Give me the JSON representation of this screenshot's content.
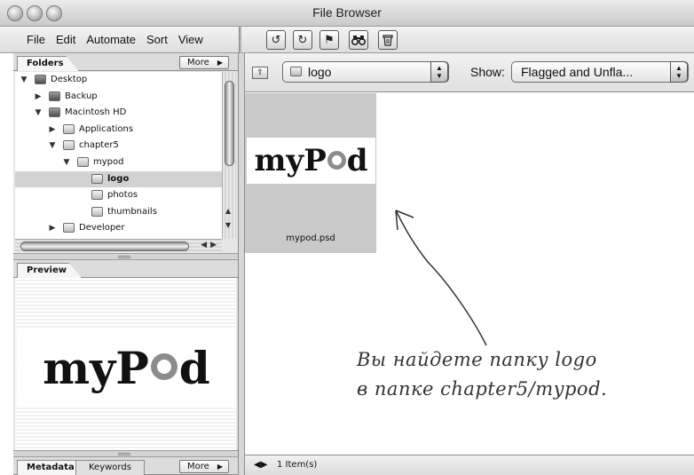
{
  "window": {
    "title": "File Browser"
  },
  "menu": [
    "File",
    "Edit",
    "Automate",
    "Sort",
    "View"
  ],
  "toolbar_buttons": [
    {
      "name": "rotate-ccw-icon",
      "glyph": "↺"
    },
    {
      "name": "rotate-cw-icon",
      "glyph": "↻"
    },
    {
      "name": "flag-icon",
      "glyph": "⚑"
    },
    {
      "name": "binoculars-icon",
      "glyph": "⊕"
    },
    {
      "name": "trash-icon",
      "glyph": "🗑"
    }
  ],
  "folders_panel": {
    "tab": "Folders",
    "more": "More",
    "tree": [
      {
        "label": "Desktop",
        "depth": 0,
        "expanded": true,
        "icon": "desktop-icon",
        "selected": false
      },
      {
        "label": "Backup",
        "depth": 1,
        "expanded": false,
        "icon": "drive-icon",
        "selected": false
      },
      {
        "label": "Macintosh HD",
        "depth": 1,
        "expanded": true,
        "icon": "drive-icon",
        "selected": false
      },
      {
        "label": "Applications",
        "depth": 2,
        "expanded": false,
        "icon": "folder-icon",
        "selected": false
      },
      {
        "label": "chapter5",
        "depth": 2,
        "expanded": true,
        "icon": "folder-icon",
        "selected": false
      },
      {
        "label": "mypod",
        "depth": 3,
        "expanded": true,
        "icon": "folder-icon",
        "selected": false
      },
      {
        "label": "logo",
        "depth": 4,
        "expanded": null,
        "icon": "folder-icon",
        "selected": true
      },
      {
        "label": "photos",
        "depth": 4,
        "expanded": null,
        "icon": "folder-icon",
        "selected": false
      },
      {
        "label": "thumbnails",
        "depth": 4,
        "expanded": null,
        "icon": "folder-icon",
        "selected": false
      },
      {
        "label": "Developer",
        "depth": 2,
        "expanded": false,
        "icon": "folder-icon",
        "selected": false
      }
    ]
  },
  "preview_panel": {
    "tab": "Preview"
  },
  "metadata_panel": {
    "tab": "Metadata",
    "tab2": "Keywords",
    "more": "More"
  },
  "location": {
    "folder": "logo"
  },
  "show": {
    "label": "Show:",
    "value": "Flagged and Unfla..."
  },
  "thumbnail": {
    "filename": "mypod.psd"
  },
  "logo": {
    "part1": "my",
    "part2": "P",
    "part3": "d"
  },
  "annotation": {
    "line1": "Вы найдете папку logo",
    "line2": "в папке chapter5/mypod."
  },
  "status": {
    "count": "1 Item(s)"
  }
}
